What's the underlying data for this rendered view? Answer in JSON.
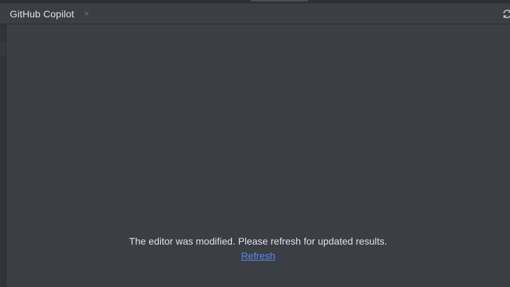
{
  "panel": {
    "title": "GitHub Copilot",
    "close_glyph": "×",
    "refresh_icon": "refresh-icon"
  },
  "content": {
    "message": "The editor was modified. Please refresh for updated results.",
    "refresh_link": "Refresh"
  },
  "colors": {
    "background": "#3b3f43",
    "text": "#dfe1e5",
    "link": "#548af7"
  }
}
